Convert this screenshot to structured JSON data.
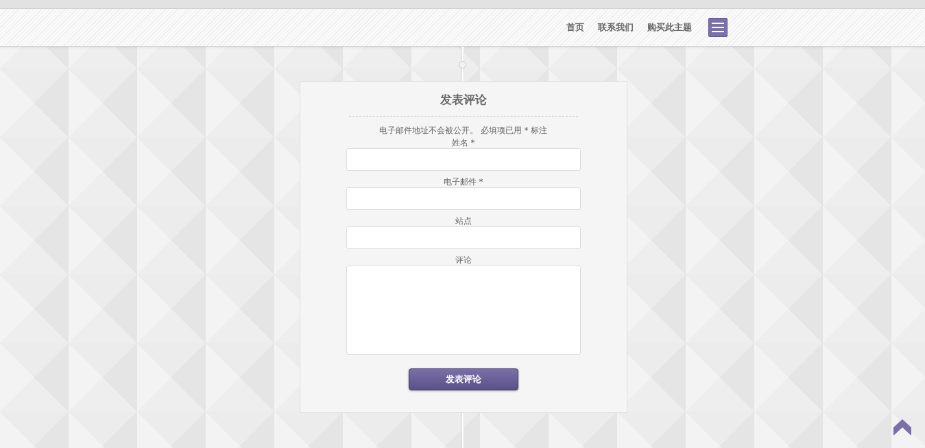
{
  "nav": {
    "links": [
      "首页",
      "联系我们",
      "购买此主题"
    ]
  },
  "form": {
    "title": "发表评论",
    "notes": "电子邮件地址不会被公开。 必填项已用 * 标注",
    "fields": [
      {
        "label": "姓名 *",
        "kind": "input"
      },
      {
        "label": "电子邮件 *",
        "kind": "input"
      },
      {
        "label": "站点",
        "kind": "input"
      },
      {
        "label": "评论",
        "kind": "textarea"
      }
    ],
    "submit": "发表评论"
  }
}
